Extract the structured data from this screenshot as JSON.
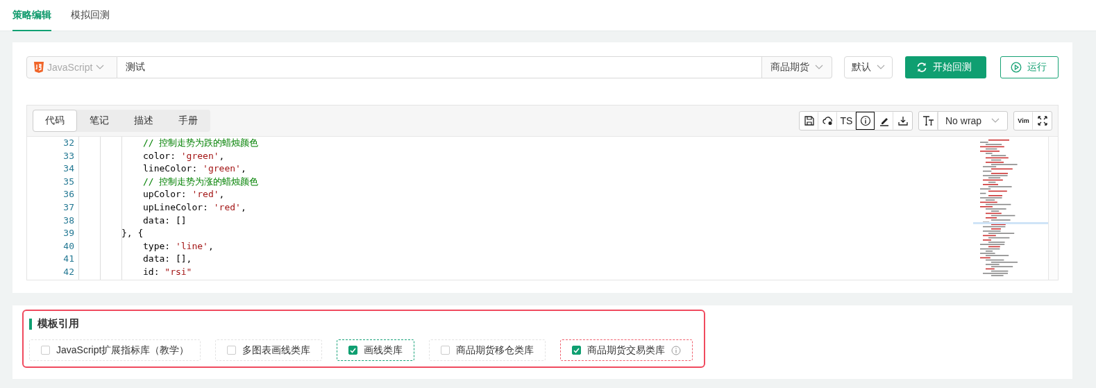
{
  "tabs": [
    {
      "label": "策略编辑",
      "selected": true
    },
    {
      "label": "模拟回测",
      "selected": false
    }
  ],
  "toolbar": {
    "language": "JavaScript",
    "name_value": "测试",
    "category": "商品期货",
    "mode": "默认",
    "backtest_button": "开始回测",
    "run_button": "运行"
  },
  "editor": {
    "tabs": [
      {
        "label": "代码",
        "selected": true
      },
      {
        "label": "笔记",
        "selected": false
      },
      {
        "label": "描述",
        "selected": false
      },
      {
        "label": "手册",
        "selected": false
      }
    ],
    "tools": [
      {
        "kind": "save",
        "selected": false
      },
      {
        "kind": "cloud",
        "selected": false
      },
      {
        "kind": "text",
        "label": "TS",
        "selected": false
      },
      {
        "kind": "info",
        "selected": true
      },
      {
        "kind": "pen",
        "selected": false
      },
      {
        "kind": "download",
        "selected": false
      }
    ],
    "wrap_select": "No wrap",
    "vim_label": "Vim",
    "lines": [
      {
        "children": [
          {
            "number": "32",
            "tokens": [
              {
                "kind": "comment",
                "text": "// 控制走势为跌的蜡烛颜色"
              }
            ]
          },
          {
            "number": "33",
            "tokens": [
              {
                "kind": "plain",
                "text": "color: "
              },
              {
                "kind": "string",
                "text": "'green'"
              },
              {
                "kind": "plain",
                "text": ","
              }
            ]
          },
          {
            "number": "34",
            "tokens": [
              {
                "kind": "plain",
                "text": "lineColor: "
              },
              {
                "kind": "string",
                "text": "'green'"
              },
              {
                "kind": "plain",
                "text": ","
              }
            ]
          },
          {
            "number": "35",
            "tokens": [
              {
                "kind": "comment",
                "text": "// 控制走势为涨的蜡烛颜色"
              }
            ]
          },
          {
            "number": "36",
            "tokens": [
              {
                "kind": "plain",
                "text": "upColor: "
              },
              {
                "kind": "string",
                "text": "'red'"
              },
              {
                "kind": "plain",
                "text": ","
              }
            ]
          },
          {
            "number": "37",
            "tokens": [
              {
                "kind": "plain",
                "text": "upLineColor: "
              },
              {
                "kind": "string",
                "text": "'red'"
              },
              {
                "kind": "plain",
                "text": ","
              }
            ]
          },
          {
            "number": "38",
            "tokens": [
              {
                "kind": "plain",
                "text": "data: []"
              }
            ]
          }
        ]
      },
      {
        "number": "39",
        "tokens": [
          {
            "kind": "plain",
            "text": "}, {"
          }
        ]
      },
      {
        "children": [
          {
            "number": "40",
            "tokens": [
              {
                "kind": "plain",
                "text": "type: "
              },
              {
                "kind": "string",
                "text": "'line'"
              },
              {
                "kind": "plain",
                "text": ","
              }
            ]
          },
          {
            "number": "41",
            "tokens": [
              {
                "kind": "plain",
                "text": "data: [],"
              }
            ]
          },
          {
            "number": "42",
            "tokens": [
              {
                "kind": "plain",
                "text": "id: "
              },
              {
                "kind": "string",
                "text": "\"rsi\""
              }
            ]
          }
        ]
      }
    ]
  },
  "templates": {
    "title": "模板引用",
    "items": [
      {
        "label": "JavaScript扩展指标库（教学）",
        "checked": false,
        "color": "#e3e3e3",
        "info": false
      },
      {
        "label": "多图表画线类库",
        "checked": false,
        "color": "#e3e3e3",
        "info": false
      },
      {
        "label": "画线类库",
        "checked": true,
        "color": "#19a37a",
        "info": false
      },
      {
        "label": "商品期货移仓类库",
        "checked": false,
        "color": "#e3e3e3",
        "info": false
      },
      {
        "label": "商品期货交易类库",
        "checked": true,
        "color": "#f0606e",
        "info": true
      }
    ]
  }
}
